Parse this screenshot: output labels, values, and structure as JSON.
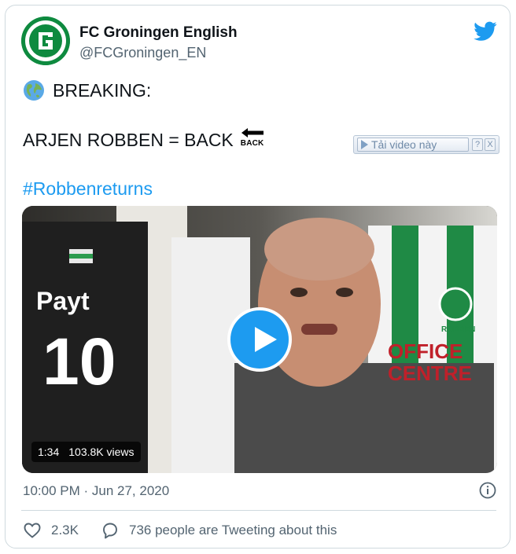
{
  "author": {
    "display_name": "FC Groningen English",
    "handle": "@FCGroningen_EN",
    "avatar_text": "FC GRONINGEN"
  },
  "tweet": {
    "line1": "BREAKING:",
    "line2": "ARJEN ROBBEN = BACK",
    "back_emoji_text": "BACK",
    "hashtag": "#Robbenreturns"
  },
  "download_overlay": {
    "label": "Tải video này",
    "help": "?",
    "close": "X"
  },
  "video": {
    "duration": "1:34",
    "views": "103.8K views",
    "jersey_sponsor_left": "Payt",
    "jersey_number": "10",
    "jersey_sponsor_right_1": "OFFICE",
    "jersey_sponsor_right_2": "CENTRE",
    "jersey_name_right": "ROBBEN"
  },
  "meta": {
    "timestamp": "10:00 PM · Jun 27, 2020"
  },
  "actions": {
    "likes": "2.3K",
    "conversation": "736 people are Tweeting about this"
  },
  "colors": {
    "twitter_blue": "#1d9bf0",
    "groningen_green": "#0e8a3f",
    "muted_text": "#536471"
  }
}
